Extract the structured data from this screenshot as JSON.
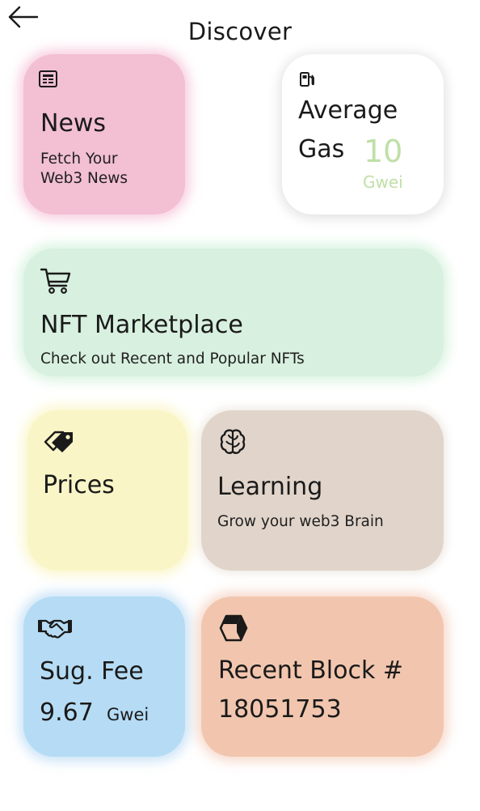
{
  "header": {
    "title": "Discover",
    "back_icon": "arrow-left-icon"
  },
  "news": {
    "icon": "newspaper-icon",
    "title": "News",
    "subtitle_line1": "Fetch Your",
    "subtitle_line2": "Web3 News",
    "color": "#f2bfd3"
  },
  "gas": {
    "icon": "gas-pump-icon",
    "title_line1": "Average",
    "title_line2": "Gas",
    "value": "10",
    "unit": "Gwei",
    "value_color": "#bfe0a8",
    "color": "#ffffff"
  },
  "nft": {
    "icon": "shopping-cart-icon",
    "title": "NFT Marketplace",
    "subtitle": "Check out Recent and Popular NFTs",
    "color": "#d8f0df"
  },
  "prices": {
    "icon": "tags-icon",
    "title": "Prices",
    "color": "#faf5c6"
  },
  "learning": {
    "icon": "brain-icon",
    "title": "Learning",
    "subtitle": "Grow your web3 Brain",
    "color": "#e1d5cb"
  },
  "fee": {
    "icon": "handshake-icon",
    "title": "Sug. Fee",
    "value": "9.67",
    "unit": "Gwei",
    "color": "#b6dcf5"
  },
  "block": {
    "icon": "cube-icon",
    "title": "Recent Block #",
    "value": "18051753",
    "color": "#f2c6ae"
  }
}
